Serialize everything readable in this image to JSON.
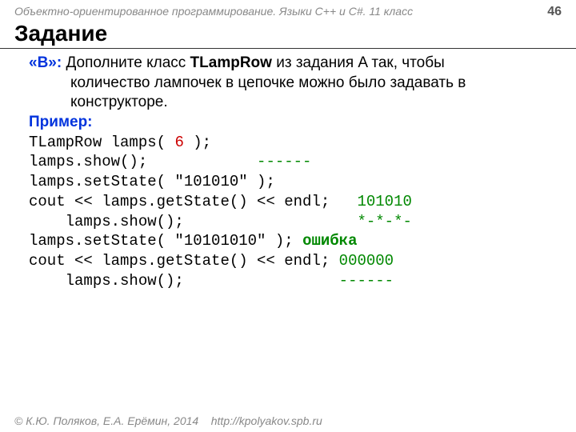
{
  "header": {
    "course": "Объектно-ориентированное программирование. Языки C++ и C#. 11 класс",
    "page": "46"
  },
  "title": "Задание",
  "task": {
    "level": "«B»:",
    "line1": " Дополните класс ",
    "class_name": "TLampRow",
    "line1b": " из задания A так, чтобы ",
    "line2": "количество лампочек в цепочке можно было задавать в ",
    "line3": "конструкторе."
  },
  "example_label": "Пример:",
  "code": {
    "l1a": "TLampRow lamps( ",
    "l1b": "6",
    "l1c": " );",
    "l2a": "lamps.show();            ",
    "l2b": "------",
    "l3": "lamps.setState( \"101010\" );",
    "l4a": "cout << lamps.getState() << endl;   ",
    "l4b": "101010",
    "l5a": "    lamps.show();                   ",
    "l5b": "*-*-*-",
    "l6a": "lamps.setState( \"10101010\" ); ",
    "l6b": "ошибка",
    "l7a": "cout << lamps.getState() << endl; ",
    "l7b": "000000",
    "l8a": "    lamps.show();                 ",
    "l8b": "------"
  },
  "footer": {
    "copyright": "© К.Ю. Поляков, Е.А. Ерёмин, 2014",
    "url": "http://kpolyakov.spb.ru"
  }
}
